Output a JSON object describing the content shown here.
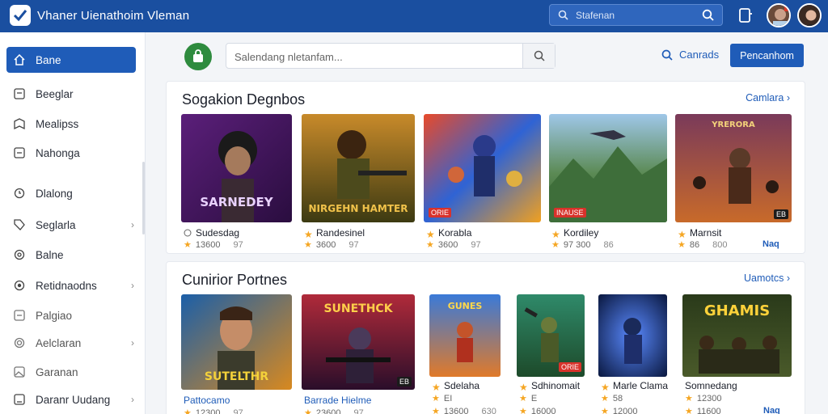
{
  "header": {
    "app_title": "Vhaner Uienathoim Vleman",
    "search_placeholder": "Stafenan"
  },
  "sidebar": {
    "items": [
      {
        "label": "Bane",
        "icon": "home-icon"
      },
      {
        "label": "Beeglar",
        "icon": "square-icon"
      },
      {
        "label": "Mealipss",
        "icon": "bookmark-icon"
      },
      {
        "label": "Nahonga",
        "icon": "square-icon"
      },
      {
        "label": "Dlalong",
        "icon": "refresh-icon"
      },
      {
        "label": "Seglarla",
        "icon": "tag-icon"
      },
      {
        "label": "Balne",
        "icon": "settings-icon"
      },
      {
        "label": "Retidnaodns",
        "icon": "circle-icon"
      },
      {
        "label": "Palgiao",
        "icon": "square-icon"
      },
      {
        "label": "Aelclaran",
        "icon": "gear-icon"
      },
      {
        "label": "Garanan",
        "icon": "image-icon"
      },
      {
        "label": "Daranr Uudang",
        "icon": "square-icon"
      }
    ]
  },
  "toolbar": {
    "search_placeholder": "Salendang nletanfam...",
    "link_label": "Canrads",
    "primary_button": "Pencanhom"
  },
  "sections": [
    {
      "title": "Sogakion Degnbos",
      "link": "Camlara",
      "cards": [
        {
          "caption": "SARNEDEY",
          "badge": "",
          "title": "Sudesdag",
          "rating": "13600",
          "meta": "97",
          "right": ""
        },
        {
          "caption": "NIRGEHN HAMTER",
          "badge": "",
          "title": "Randesinel",
          "rating": "3600",
          "meta": "97",
          "right": ""
        },
        {
          "caption": "",
          "badge": "ORIE",
          "title": "Korabla",
          "rating": "3600",
          "meta": "97",
          "right": ""
        },
        {
          "caption": "",
          "badge": "INAUSE",
          "title": "Kordiley",
          "rating": "97 300",
          "meta": "86",
          "right": ""
        },
        {
          "caption": "YRERORA",
          "badge": "EB",
          "title": "Marnsit",
          "rating": "86",
          "meta": "800",
          "right": "Naq"
        }
      ]
    },
    {
      "title": "Cunirior Portnes",
      "link": "Uamotcs",
      "cards": [
        {
          "caption": "SUTELTHR",
          "badge": "",
          "title": "Pattocamo",
          "rating": "12300",
          "meta": "97",
          "right": ""
        },
        {
          "caption": "SUNETHCK",
          "badge": "EB",
          "title": "Barrade Hielme",
          "rating": "23600",
          "meta": "97",
          "right": ""
        },
        {
          "caption": "GUNES",
          "badge": "",
          "title": "Sdelaha",
          "rating": "EI",
          "meta": "13600",
          "extra": "630"
        },
        {
          "caption": "",
          "badge": "ORIE",
          "title": "Sdhinomait",
          "rating": "E",
          "meta": "16000",
          "extra": ""
        },
        {
          "caption": "",
          "badge": "",
          "title": "Marle Clama",
          "rating": "58",
          "meta": "12000",
          "extra": ""
        },
        {
          "caption": "GHAMIS",
          "badge": "",
          "title": "Somnedang",
          "rating": "12300",
          "meta": "11600",
          "right": "Naq"
        }
      ]
    }
  ],
  "colors": {
    "topbar": "#1a4fa0",
    "accent": "#1f5cb8",
    "star": "#f5a623"
  }
}
